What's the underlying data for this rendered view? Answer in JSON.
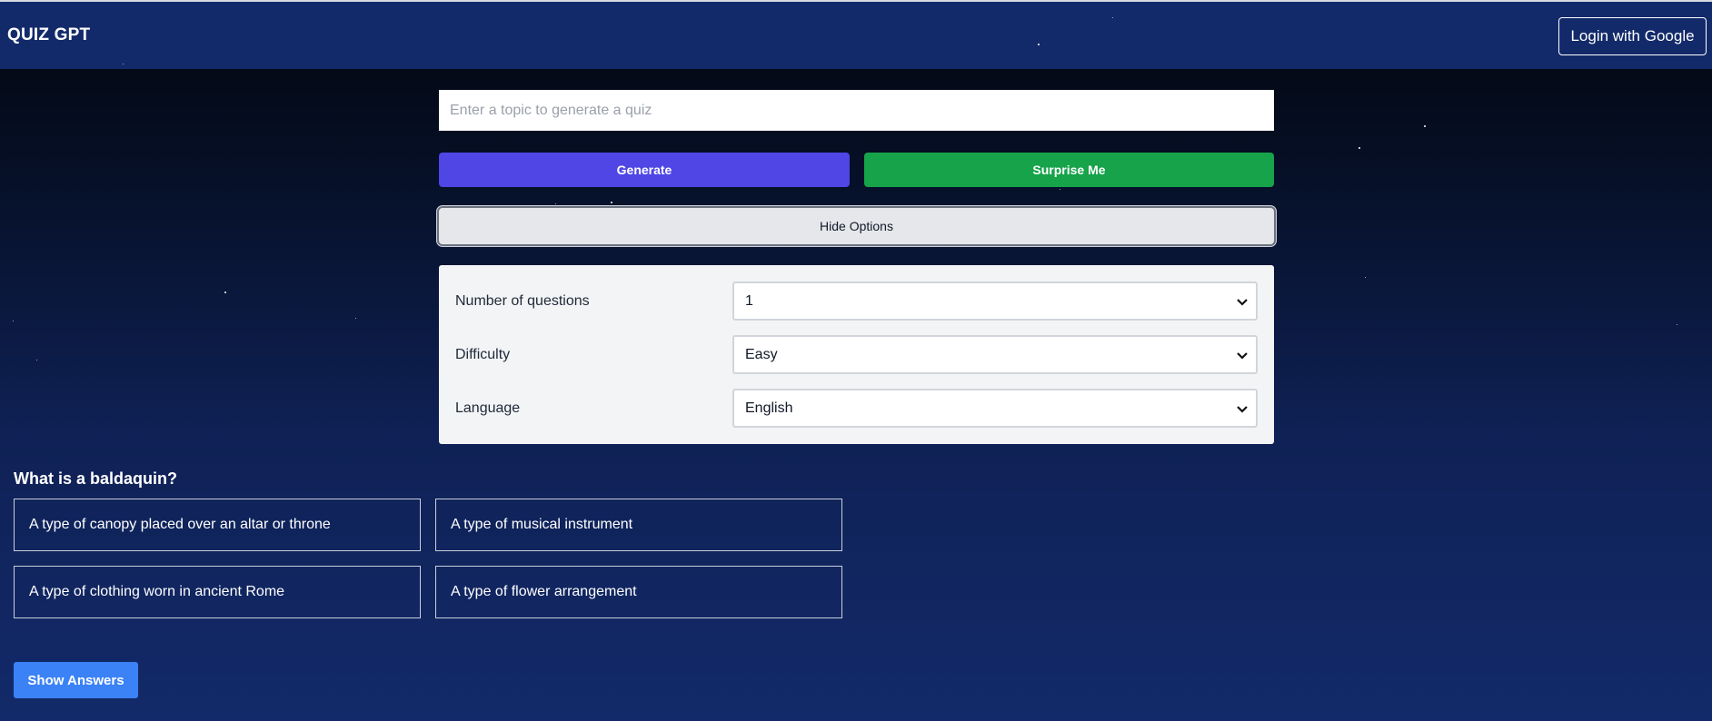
{
  "header": {
    "brand": "QUIZ GPT",
    "login_label": "Login with Google"
  },
  "topic": {
    "value": "",
    "placeholder": "Enter a topic to generate a quiz"
  },
  "actions": {
    "generate_label": "Generate",
    "surprise_label": "Surprise Me",
    "toggle_options_label": "Hide Options"
  },
  "options": [
    {
      "label": "Number of questions",
      "value": "1"
    },
    {
      "label": "Difficulty",
      "value": "Easy"
    },
    {
      "label": "Language",
      "value": "English"
    }
  ],
  "quiz": {
    "question": "What is a baldaquin?",
    "answers": [
      "A type of canopy placed over an altar or throne",
      "A type of musical instrument",
      "A type of clothing worn in ancient Rome",
      "A type of flower arrangement"
    ],
    "show_answers_label": "Show Answers"
  },
  "icons": {
    "select": "chevron-down-icon"
  },
  "colors": {
    "header_bg": "#132a6a",
    "generate": "#4f46e5",
    "surprise": "#16a34a",
    "show_answers": "#3b82f6"
  }
}
